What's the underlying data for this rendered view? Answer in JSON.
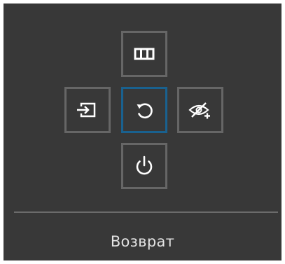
{
  "menu": {
    "selected_label": "Возврат",
    "buttons": [
      {
        "position": "up",
        "icon": "menu-grid-icon"
      },
      {
        "position": "left",
        "icon": "source-input-icon"
      },
      {
        "position": "center",
        "icon": "return-arrow-icon",
        "selected": true
      },
      {
        "position": "right",
        "icon": "eye-saver-icon"
      },
      {
        "position": "down",
        "icon": "power-icon"
      }
    ]
  },
  "colors": {
    "panel_bg": "#383838",
    "button_border": "#666666",
    "selected_border": "#19618f",
    "icon_stroke": "#ffffff",
    "divider": "#6b6b6b",
    "label_text": "#e3e3e3"
  }
}
